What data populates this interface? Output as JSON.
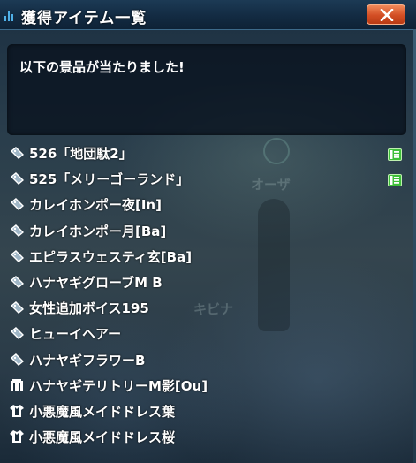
{
  "window": {
    "title": "獲得アイテム一覧",
    "close_icon": "close-x-icon"
  },
  "message": {
    "text": "以下の景品が当たりました!"
  },
  "background": {
    "ghost_text_1": "オーザ",
    "ghost_text_2": "キビナ"
  },
  "items": [
    {
      "label": "526「地団駄2」",
      "icon": "ticket-icon",
      "badge": "new-item-badge"
    },
    {
      "label": "525「メリーゴーランド」",
      "icon": "ticket-icon",
      "badge": "new-item-badge"
    },
    {
      "label": "カレイホンポー夜[In]",
      "icon": "ticket-icon",
      "badge": ""
    },
    {
      "label": "カレイホンポー月[Ba]",
      "icon": "ticket-icon",
      "badge": ""
    },
    {
      "label": "エピラスウェスティ玄[Ba]",
      "icon": "ticket-icon",
      "badge": ""
    },
    {
      "label": "ハナヤギグローブM B",
      "icon": "ticket-icon",
      "badge": ""
    },
    {
      "label": "女性追加ボイス195",
      "icon": "ticket-icon",
      "badge": ""
    },
    {
      "label": "ヒューイヘアー",
      "icon": "ticket-icon",
      "badge": ""
    },
    {
      "label": "ハナヤギフラワーB",
      "icon": "ticket-icon",
      "badge": ""
    },
    {
      "label": "ハナヤギテリトリーM影[Ou]",
      "icon": "room-item-icon",
      "badge": ""
    },
    {
      "label": "小悪魔風メイドドレス葉",
      "icon": "costume-icon",
      "badge": ""
    },
    {
      "label": "小悪魔風メイドドレス桜",
      "icon": "costume-icon",
      "badge": ""
    }
  ],
  "colors": {
    "title_bar": "#132b42",
    "close_button": "#d24e24",
    "badge_green": "#3fbf3a",
    "text": "#ffffff"
  }
}
